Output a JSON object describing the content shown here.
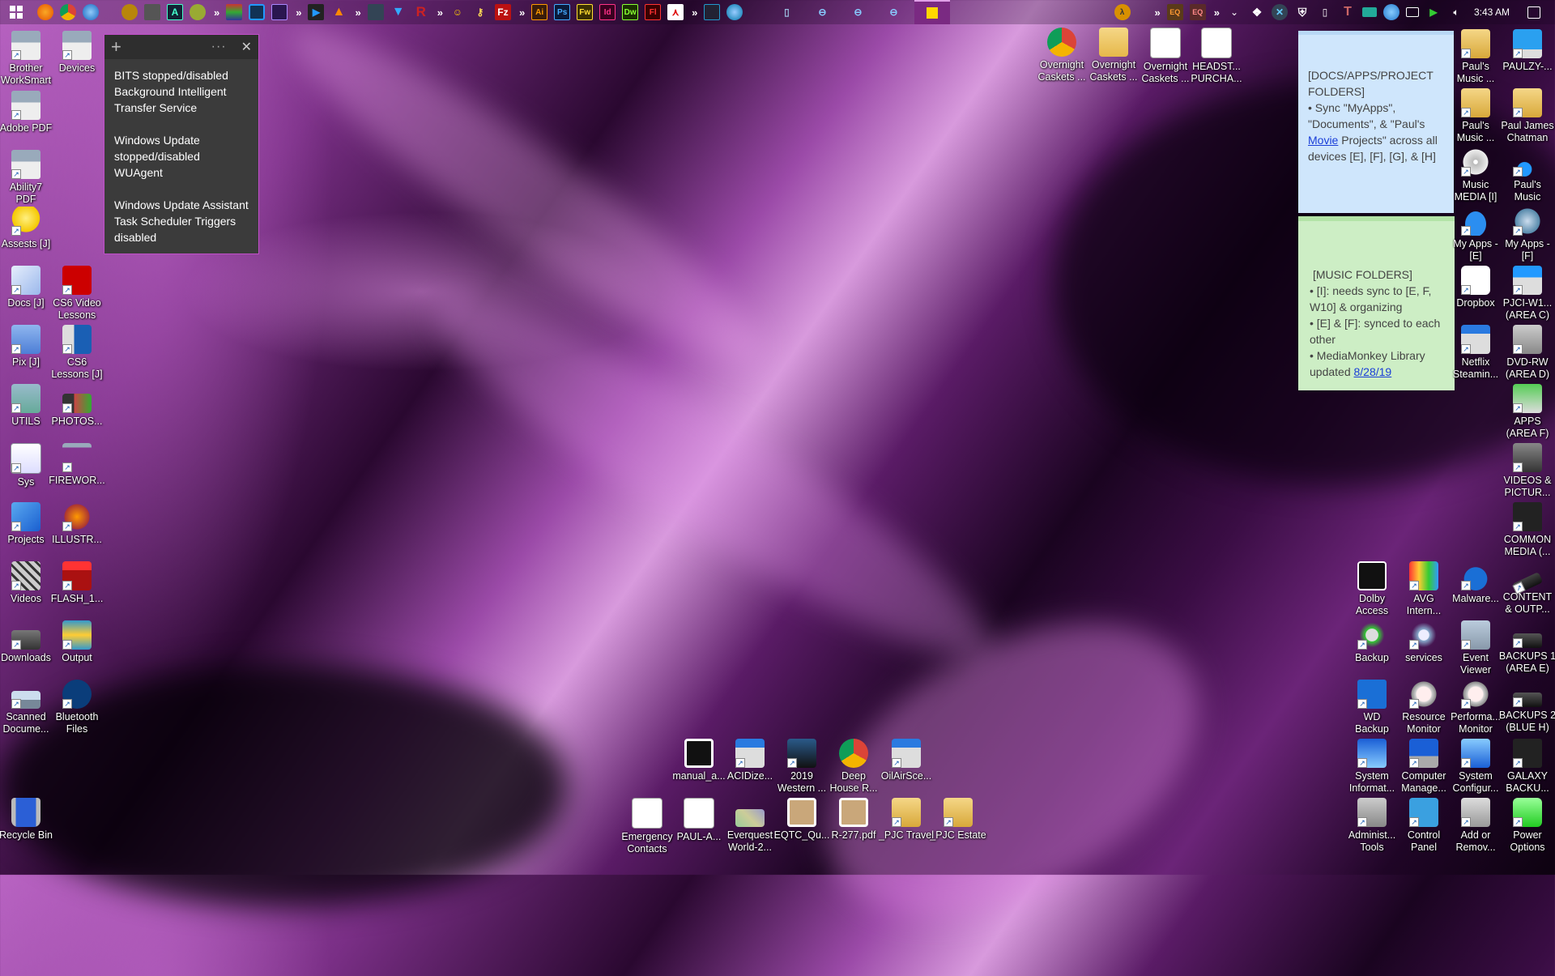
{
  "taskbar": {
    "start_icon": "windows-logo",
    "pinned_groups": [
      [
        "firefox",
        "chrome",
        "thunderbird"
      ],
      [
        "shield-app",
        "skull-app",
        "a-app",
        "router-app"
      ],
      [
        "winrar",
        "sync-app",
        "premiere-app"
      ],
      [
        "media-player",
        "vlc"
      ],
      [
        "game-app",
        "triangle-app",
        "r-app"
      ],
      [
        "character-app",
        "keys-app",
        "filezilla"
      ],
      [
        "Ai",
        "Ps",
        "Fw",
        "Id",
        "Dw",
        "Fl",
        "acrobat"
      ],
      [
        "film-app",
        "globe-app"
      ],
      [
        "phone-app",
        "connect-1",
        "connect-2",
        "connect-3",
        "sticky-notes"
      ]
    ],
    "adobe_labels": [
      "Ai",
      "Ps",
      "Fw",
      "Id",
      "Dw",
      "Fl"
    ],
    "tray_icons": [
      "half-life",
      "eq",
      "eq2",
      "chevron-up",
      "dropbox",
      "x-app",
      "defender",
      "usb",
      "t-app",
      "keyboard",
      "network-cloud",
      "display",
      "arrows",
      "volume"
    ],
    "clock": "3:43 AM",
    "notification_icon": "action-center"
  },
  "sticky_dark": {
    "add_label": "+",
    "menu_label": "···",
    "close_label": "✕",
    "paragraphs": [
      "BITS stopped/disabled\nBackground Intelligent\nTransfer Service",
      "Windows Update\nstopped/disabled\nWUAgent",
      "Windows Update Assistant\nTask Scheduler Triggers\ndisabled"
    ]
  },
  "sticky_blue": {
    "line1": "[DOCS/APPS/PROJECT FOLDERS]",
    "line2": "• Sync \"MyApps\", \"Documents\", & \"Paul's ",
    "link": "Movie",
    "line3": " Projects\" across all devices [E], [F], [G], & [H]"
  },
  "sticky_green": {
    "title": "[MUSIC FOLDERS]",
    "b1": "• [I]: needs sync to [E, F, W10] & organizing",
    "b2": "• [E] & [F]: synced to each other",
    "b3": "• MediaMonkey Library updated ",
    "b3_link": "8/28/19"
  },
  "left_icons": [
    {
      "label": "Brother\nWorkSmart",
      "icon": "printer"
    },
    {
      "label": "Devices",
      "icon": "printer"
    },
    {
      "label": "Adobe PDF",
      "icon": "printer"
    },
    {
      "label": "Ability7\nPDF",
      "icon": "printer"
    },
    {
      "label": "Assests [J]",
      "icon": "lightbulb"
    },
    {
      "label": "Docs [J]",
      "icon": "document"
    },
    {
      "label": "CS6 Video\nLessons",
      "icon": "flash"
    },
    {
      "label": "Pix [J]",
      "icon": "pictures-folder"
    },
    {
      "label": "CS6\nLessons [J]",
      "icon": "monitor"
    },
    {
      "label": "UTILS",
      "icon": "utils-folder"
    },
    {
      "label": "PHOTOS...",
      "icon": "photo"
    },
    {
      "label": "Sys",
      "icon": "system"
    },
    {
      "label": "FIREWOR...",
      "icon": "fireworks"
    },
    {
      "label": "Projects",
      "icon": "projects"
    },
    {
      "label": "ILLUSTR...",
      "icon": "illustrator"
    },
    {
      "label": "Videos",
      "icon": "film"
    },
    {
      "label": "FLASH_1...",
      "icon": "fla-file"
    },
    {
      "label": "Downloads",
      "icon": "drive"
    },
    {
      "label": "Output",
      "icon": "video-output"
    },
    {
      "label": "Scanned\nDocume...",
      "icon": "scanner"
    },
    {
      "label": "Bluetooth\nFiles",
      "icon": "bluetooth"
    },
    {
      "label": "Recycle Bin",
      "icon": "recycle-bin"
    }
  ],
  "top_icons": [
    {
      "label": "Overnight\nCaskets ...",
      "icon": "chrome"
    },
    {
      "label": "Overnight\nCaskets ...",
      "icon": "word-folder"
    },
    {
      "label": "Overnight\nCaskets ...",
      "icon": "document-thumb"
    },
    {
      "label": "HEADST...\nPURCHA...",
      "icon": "document-thumb"
    }
  ],
  "right_icons": [
    {
      "label": "Paul's\nMusic ...",
      "icon": "music-folder"
    },
    {
      "label": "PAULZY-...",
      "icon": "computer"
    },
    {
      "label": "Paul's\nMusic ...",
      "icon": "music-folder"
    },
    {
      "label": "Paul James\nChatman",
      "icon": "user-folder"
    },
    {
      "label": "Music\nMEDIA [I]",
      "icon": "music-cd"
    },
    {
      "label": "Paul's\nMusic",
      "icon": "music-note"
    },
    {
      "label": "My Apps -\n[E]",
      "icon": "cloud"
    },
    {
      "label": "My Apps -\n[F]",
      "icon": "info"
    },
    {
      "label": "Dropbox",
      "icon": "dropbox"
    },
    {
      "label": "PJCI-W1...\n(AREA C)",
      "icon": "windows-drive"
    },
    {
      "label": "Netflix\nSteamin...",
      "icon": "text-editor"
    },
    {
      "label": "DVD-RW\n(AREA D)",
      "icon": "dvd-drive"
    },
    {
      "label": "APPS\n(AREA F)",
      "icon": "apps-drive"
    },
    {
      "label": "VIDEOS &\nPICTUR...",
      "icon": "camcorder"
    },
    {
      "label": "COMMON\nMEDIA (...",
      "icon": "black-drive"
    },
    {
      "label": "Dolby\nAccess",
      "icon": "dolby"
    },
    {
      "label": "AVG\nIntern...",
      "icon": "avg"
    },
    {
      "label": "Malware...",
      "icon": "malwarebytes"
    },
    {
      "label": "CONTENT\n& OUTP...",
      "icon": "usb-stick"
    },
    {
      "label": "Backup",
      "icon": "backup"
    },
    {
      "label": "services",
      "icon": "gears"
    },
    {
      "label": "Event\nViewer",
      "icon": "event-viewer"
    },
    {
      "label": "BACKUPS 1\n(AREA E)",
      "icon": "external-drive"
    },
    {
      "label": "WD\nBackup",
      "icon": "wd-backup"
    },
    {
      "label": "Resource\nMonitor",
      "icon": "gauge"
    },
    {
      "label": "Performa...\nMonitor",
      "icon": "gauge"
    },
    {
      "label": "BACKUPS 2\n(BLUE H)",
      "icon": "external-drive"
    },
    {
      "label": "System\nInformat...",
      "icon": "system-info"
    },
    {
      "label": "Computer\nManage...",
      "icon": "computer-management"
    },
    {
      "label": "System\nConfigur...",
      "icon": "system-config"
    },
    {
      "label": "GALAXY\nBACKU...",
      "icon": "black-drive"
    },
    {
      "label": "Administ...\nTools",
      "icon": "admin-tools"
    },
    {
      "label": "Control\nPanel",
      "icon": "control-panel"
    },
    {
      "label": "Add or\nRemov...",
      "icon": "add-remove"
    },
    {
      "label": "Power\nOptions",
      "icon": "battery"
    }
  ],
  "bottom_icons": [
    {
      "label": "manual_a...",
      "icon": "thumb-dark"
    },
    {
      "label": "ACIDize...",
      "icon": "text-editor"
    },
    {
      "label": "2019\nWestern ...",
      "icon": "video-file"
    },
    {
      "label": "Deep\nHouse R...",
      "icon": "chrome"
    },
    {
      "label": "OilAirSce...",
      "icon": "text-editor"
    },
    {
      "label": "Emergency\nContacts",
      "icon": "document-thumb"
    },
    {
      "label": "PAUL-A...",
      "icon": "document-thumb"
    },
    {
      "label": "Everquest\nWorld-2...",
      "icon": "map-thumb"
    },
    {
      "label": "EQTC_Qu...",
      "icon": "parchment"
    },
    {
      "label": "R-277.pdf",
      "icon": "parchment"
    },
    {
      "label": "_PJC Travel",
      "icon": "pdf-folder"
    },
    {
      "label": "_PJC Estate",
      "icon": "pdf-folder"
    }
  ]
}
